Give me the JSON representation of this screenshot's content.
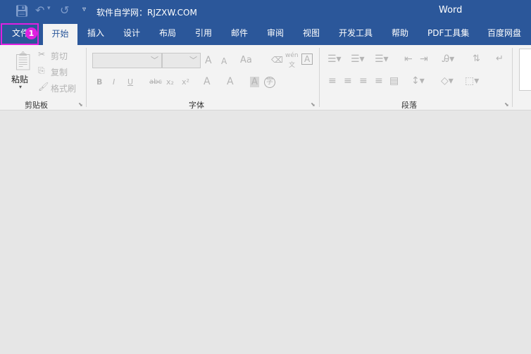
{
  "titlebar": {
    "doc_title": "软件自学网：RJZXW.COM",
    "app_name": "Word"
  },
  "tabs": [
    {
      "label": "文件"
    },
    {
      "label": "开始"
    },
    {
      "label": "插入"
    },
    {
      "label": "设计"
    },
    {
      "label": "布局"
    },
    {
      "label": "引用"
    },
    {
      "label": "邮件"
    },
    {
      "label": "审阅"
    },
    {
      "label": "视图"
    },
    {
      "label": "开发工具"
    },
    {
      "label": "帮助"
    },
    {
      "label": "PDF工具集"
    },
    {
      "label": "百度网盘"
    }
  ],
  "annotation": {
    "badge": "1",
    "color": "#e020e0"
  },
  "clipboard": {
    "paste": "粘贴",
    "cut": "剪切",
    "copy": "复制",
    "format_painter": "格式刷",
    "label": "剪贴板"
  },
  "font": {
    "label": "字体",
    "grow": "A",
    "shrink": "A",
    "change_case": "Aa",
    "bold": "B",
    "italic": "I",
    "underline": "U",
    "strike": "abc",
    "sub": "x₂",
    "sup": "x²",
    "effects": "A",
    "color": "A",
    "shade": "A",
    "enclose": "字",
    "phonetic_top": "wén",
    "phonetic_bottom": "文",
    "border": "A"
  },
  "paragraph": {
    "label": "段落"
  },
  "colors": {
    "title_bg": "#2b579a",
    "ribbon_bg": "#f3f3f3",
    "canvas": "#e6e6e6"
  }
}
